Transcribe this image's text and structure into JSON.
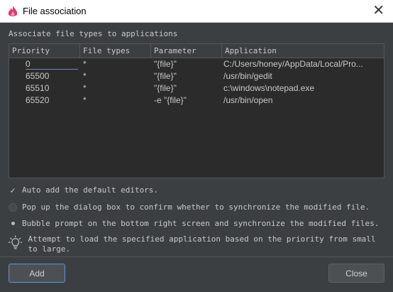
{
  "window": {
    "title": "File association",
    "close_glyph": "✕",
    "icon": "app-logo-icon",
    "icon_color": "#e8336e"
  },
  "heading": "Associate file types to applications",
  "table": {
    "columns": [
      "Priority",
      "File types",
      "Parameter",
      "Application"
    ],
    "rows": [
      {
        "priority": "0",
        "file_types": "*",
        "parameter": "\"{file}\"",
        "application": "C:/Users/honey/AppData/Local/Pro..."
      },
      {
        "priority": "65500",
        "file_types": "*",
        "parameter": "\"{file}\"",
        "application": "/usr/bin/gedit"
      },
      {
        "priority": "65510",
        "file_types": "*",
        "parameter": "\"{file}\"",
        "application": "c:\\windows\\notepad.exe"
      },
      {
        "priority": "65520",
        "file_types": "*",
        "parameter": "-e \"{file}\"",
        "application": "/usr/bin/open"
      }
    ]
  },
  "options": {
    "auto_add": {
      "label": "Auto add the default editors.",
      "checked": true
    },
    "popup_dialog": {
      "label": "Pop up the dialog box to confirm whether to synchronize the modified file.",
      "selected": false
    },
    "bubble_prompt": {
      "label": "Bubble prompt on the bottom right screen and synchronize the modified files.",
      "selected": true
    }
  },
  "hint": {
    "icon": "lightbulb-icon",
    "text": "Attempt to load the specified application based on the priority from small to large."
  },
  "buttons": {
    "add": "Add",
    "close": "Close"
  }
}
